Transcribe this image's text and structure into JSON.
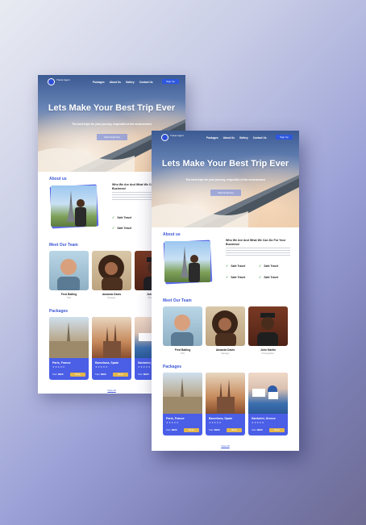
{
  "brand": {
    "name": "Travel Agent"
  },
  "nav": {
    "items": [
      "Packages",
      "About Us",
      "Gallery",
      "Contact Us"
    ],
    "cta": "Sign Up"
  },
  "hero": {
    "title": "Lets Make Your Best Trip Ever",
    "subtitle": "The best trips for your journey, respectful of the environment",
    "button": "Start Exploring"
  },
  "about": {
    "title": "About us",
    "heading": "Who We Are And What We Can Do For Your Business!",
    "features": [
      "Safe Travel",
      "Safe Travel",
      "Safe Travel",
      "Safe Travel"
    ]
  },
  "team": {
    "title": "Meet Our Team",
    "members": [
      {
        "name": "Fred Bailing",
        "role": "Pilot"
      },
      {
        "name": "Amanda Davis",
        "role": "Manager"
      },
      {
        "name": "John Martin",
        "role": "Photographer"
      }
    ]
  },
  "packages": {
    "title": "Packages",
    "items": [
      {
        "name": "Paris, France",
        "price": "$999",
        "button": "Book"
      },
      {
        "name": "Barcelona, Spain",
        "price": "$999",
        "button": "Book"
      },
      {
        "name": "Santorini, Greece",
        "price": "$999",
        "button": "Book"
      }
    ],
    "stars": "★★★★★",
    "price_prefix": "from",
    "view_all": "View All"
  },
  "colors": {
    "accent": "#3c57d6",
    "button": "#e3b64a",
    "card": "#4a5ee6"
  }
}
